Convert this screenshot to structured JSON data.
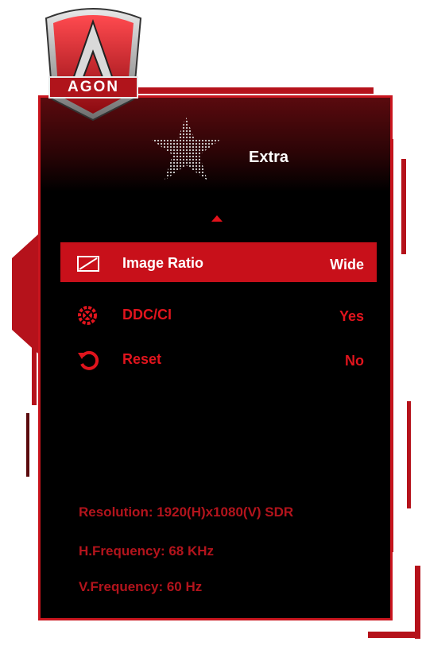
{
  "brand": {
    "logo_text": "AGON"
  },
  "header": {
    "title": "Extra"
  },
  "menu": {
    "items": [
      {
        "icon": "image-ratio-icon",
        "label": "Image Ratio",
        "value": "Wide",
        "selected": true
      },
      {
        "icon": "ddc-ci-icon",
        "label": "DDC/CI",
        "value": "Yes",
        "selected": false
      },
      {
        "icon": "reset-icon",
        "label": "Reset",
        "value": "No",
        "selected": false
      }
    ]
  },
  "info": {
    "resolution": "Resolution: 1920(H)x1080(V) SDR",
    "h_frequency": "H.Frequency: 68 KHz",
    "v_frequency": "V.Frequency: 60 Hz"
  },
  "colors": {
    "accent": "#c8101a",
    "text_red": "#e0141d",
    "info_red": "#b3141c",
    "panel_bg": "#000000"
  }
}
